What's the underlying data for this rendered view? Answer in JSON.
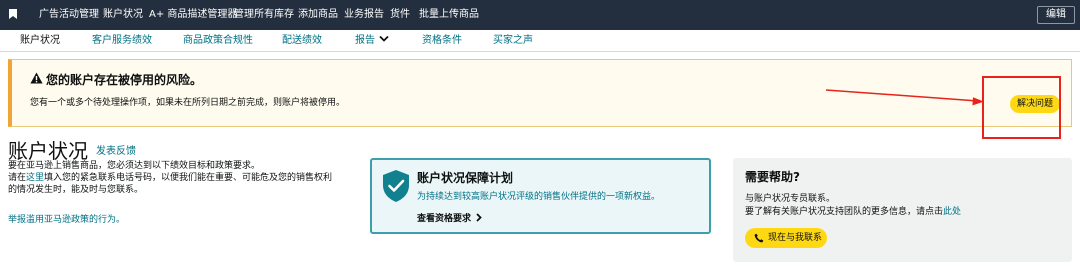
{
  "topnav": {
    "items": [
      "广告活动管理",
      "账户状况",
      "A+ 商品描述管理器",
      "管理所有库存",
      "添加商品",
      "业务报告",
      "货件",
      "批量上传商品"
    ],
    "edit_label": "编辑",
    "bookmark_icon": "bookmark-icon"
  },
  "subnav": {
    "items": [
      "账户状况",
      "客户服务绩效",
      "商品政策合规性",
      "配送绩效",
      "报告",
      "资格条件",
      "买家之声"
    ],
    "active_index": 0,
    "dropdown_item_index": 4
  },
  "banner": {
    "icon": "warning-icon",
    "title": "您的账户存在被停用的风险。",
    "description": "您有一个或多个待处理操作项，如果未在所列日期之前完成，则账户将被停用。",
    "resolve_label": "解决问题"
  },
  "health": {
    "title": "账户状况",
    "feedback_link": "发表反馈",
    "intro_line1": "要在亚马逊上销售商品，您必须达到以下绩效目标和政策要求。",
    "intro_line2_pre": "请在",
    "intro_line2_link": "这里",
    "intro_line2_post": "填入您的紧急联系电话号码，以便我们能在重要、可能危及您的销售权利",
    "intro_line3": "的情况发生时，能及时与您联系。",
    "report_link": "举报滥用亚马逊政策的行为。"
  },
  "protection_card": {
    "icon": "shield-check-icon",
    "title": "账户状况保障计划",
    "description": "为持续达到较高账户状况评级的销售伙伴提供的一项新权益。",
    "link_label": "查看资格要求"
  },
  "help": {
    "title": "需要帮助?",
    "line1": "与账户状况专员联系。",
    "line2_pre": "要了解有关账户状况支持团队的更多信息，请点击",
    "line2_link": "此处",
    "contact_label": "现在与我联系",
    "contact_icon": "phone-icon"
  },
  "colors": {
    "topbar": "#232f3e",
    "link": "#007185",
    "button_yellow": "#ffd814",
    "banner_bg": "#fffbee",
    "banner_accent": "#f0a536",
    "annotation_red": "#e8231b",
    "card_border": "#3d9fab"
  }
}
